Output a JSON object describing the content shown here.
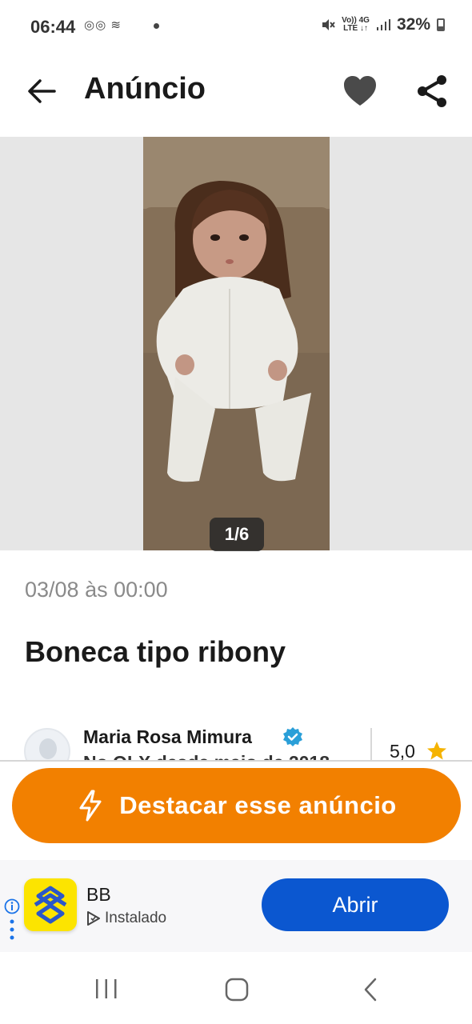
{
  "status_bar": {
    "time": "06:44",
    "left_icons": "◎◎ ≋",
    "network_top": "Vo)) 4G",
    "network_bottom": "LTE ↓↑",
    "battery": "32%"
  },
  "header": {
    "title": "Anúncio",
    "back_icon": "arrow-left-icon",
    "favorite_icon": "heart-icon",
    "share_icon": "share-icon"
  },
  "gallery": {
    "counter": "1/6",
    "image_description_icon": "doll-photo"
  },
  "listing": {
    "date": "03/08 às 00:00",
    "title": "Boneca tipo ribony"
  },
  "seller": {
    "name": "Maria Rosa Mimura",
    "subtitle": "No OLX desde maio de 2018",
    "rating": "5,0"
  },
  "cta": {
    "label": "Destacar esse anúncio",
    "icon": "lightning-icon"
  },
  "ad": {
    "app_name": "BB",
    "status": "Instalado",
    "button": "Abrir"
  },
  "colors": {
    "accent_orange": "#f28000",
    "ad_button_blue": "#0b57d0",
    "verified_blue": "#2a9fd8",
    "star_yellow": "#f5b301",
    "bb_yellow": "#fce400",
    "bb_blue": "#2a57c9"
  }
}
